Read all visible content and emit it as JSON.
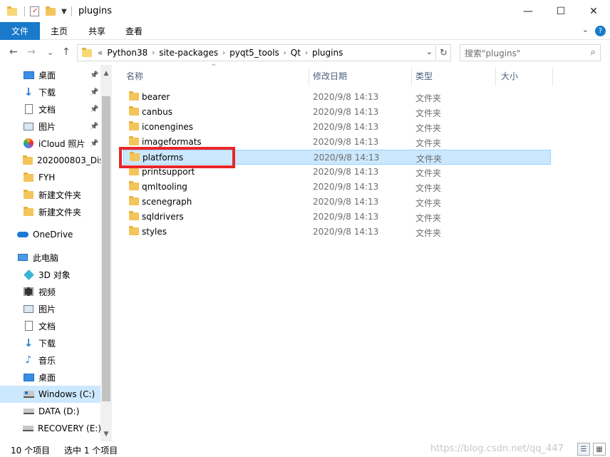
{
  "window": {
    "title": "plugins",
    "controls": {
      "minimize": "—",
      "maximize": "☐",
      "close": "✕"
    }
  },
  "ribbon": {
    "tabs": [
      "文件",
      "主页",
      "共享",
      "查看"
    ],
    "help": "?",
    "expand": "⌄"
  },
  "address": {
    "back": "←",
    "forward": "→",
    "recent": "⌄",
    "up": "↑",
    "overflow": "«",
    "crumbs": [
      "Python38",
      "site-packages",
      "pyqt5_tools",
      "Qt",
      "plugins"
    ],
    "separator": "›",
    "dropdown": "⌄",
    "refresh": "↻",
    "search_placeholder": "搜索\"plugins\"",
    "search_icon": "⌕"
  },
  "sidebar": {
    "items": [
      {
        "label": "桌面",
        "icon": "desktop-icon",
        "pinned": true
      },
      {
        "label": "下载",
        "icon": "download-icon",
        "pinned": true
      },
      {
        "label": "文档",
        "icon": "document-icon",
        "pinned": true
      },
      {
        "label": "图片",
        "icon": "picture-icon",
        "pinned": true
      },
      {
        "label": "iCloud 照片",
        "icon": "icloud-photos-icon",
        "pinned": true
      },
      {
        "label": "202000803_Dis",
        "icon": "folder-icon",
        "pinned": false
      },
      {
        "label": "FYH",
        "icon": "folder-icon",
        "pinned": false
      },
      {
        "label": "新建文件夹",
        "icon": "folder-icon",
        "pinned": false
      },
      {
        "label": "新建文件夹",
        "icon": "folder-icon",
        "pinned": false
      },
      {
        "label": "OneDrive",
        "icon": "onedrive-icon",
        "pinned": false
      },
      {
        "label": "此电脑",
        "icon": "this-pc-icon",
        "pinned": false
      },
      {
        "label": "3D 对象",
        "icon": "3d-objects-icon",
        "pinned": false
      },
      {
        "label": "视频",
        "icon": "video-icon",
        "pinned": false
      },
      {
        "label": "图片",
        "icon": "picture-icon",
        "pinned": false
      },
      {
        "label": "文档",
        "icon": "document-icon",
        "pinned": false
      },
      {
        "label": "下载",
        "icon": "download-icon",
        "pinned": false
      },
      {
        "label": "音乐",
        "icon": "music-icon",
        "pinned": false
      },
      {
        "label": "桌面",
        "icon": "desktop-icon",
        "pinned": false
      },
      {
        "label": "Windows (C:)",
        "icon": "windows-drive-icon",
        "pinned": false,
        "selected": true
      },
      {
        "label": "DATA (D:)",
        "icon": "drive-icon",
        "pinned": false
      },
      {
        "label": "RECOVERY (E:)",
        "icon": "drive-icon",
        "pinned": false
      }
    ],
    "pin_glyph": "📌",
    "scroll_up": "▲",
    "scroll_down": "▼"
  },
  "list": {
    "headers": {
      "name": "名称",
      "date": "修改日期",
      "type": "类型",
      "size": "大小"
    },
    "sort_indicator": "^",
    "rows": [
      {
        "name": "bearer",
        "date": "2020/9/8 14:13",
        "type": "文件夹"
      },
      {
        "name": "canbus",
        "date": "2020/9/8 14:13",
        "type": "文件夹"
      },
      {
        "name": "iconengines",
        "date": "2020/9/8 14:13",
        "type": "文件夹"
      },
      {
        "name": "imageformats",
        "date": "2020/9/8 14:13",
        "type": "文件夹"
      },
      {
        "name": "platforms",
        "date": "2020/9/8 14:13",
        "type": "文件夹",
        "selected": true
      },
      {
        "name": "printsupport",
        "date": "2020/9/8 14:13",
        "type": "文件夹"
      },
      {
        "name": "qmltooling",
        "date": "2020/9/8 14:13",
        "type": "文件夹"
      },
      {
        "name": "scenegraph",
        "date": "2020/9/8 14:13",
        "type": "文件夹"
      },
      {
        "name": "sqldrivers",
        "date": "2020/9/8 14:13",
        "type": "文件夹"
      },
      {
        "name": "styles",
        "date": "2020/9/8 14:13",
        "type": "文件夹"
      }
    ]
  },
  "status": {
    "item_count": "10 个项目",
    "selected_count": "选中 1 个项目",
    "watermark": "https://blog.csdn.net/qq_447",
    "details_view": "☰",
    "icons_view": "▦"
  },
  "colors": {
    "accent": "#1979ca",
    "selection": "#cce8ff",
    "selection_border": "#99d1ff",
    "highlight_box": "#e8262a",
    "folder": "#f3c55a"
  }
}
